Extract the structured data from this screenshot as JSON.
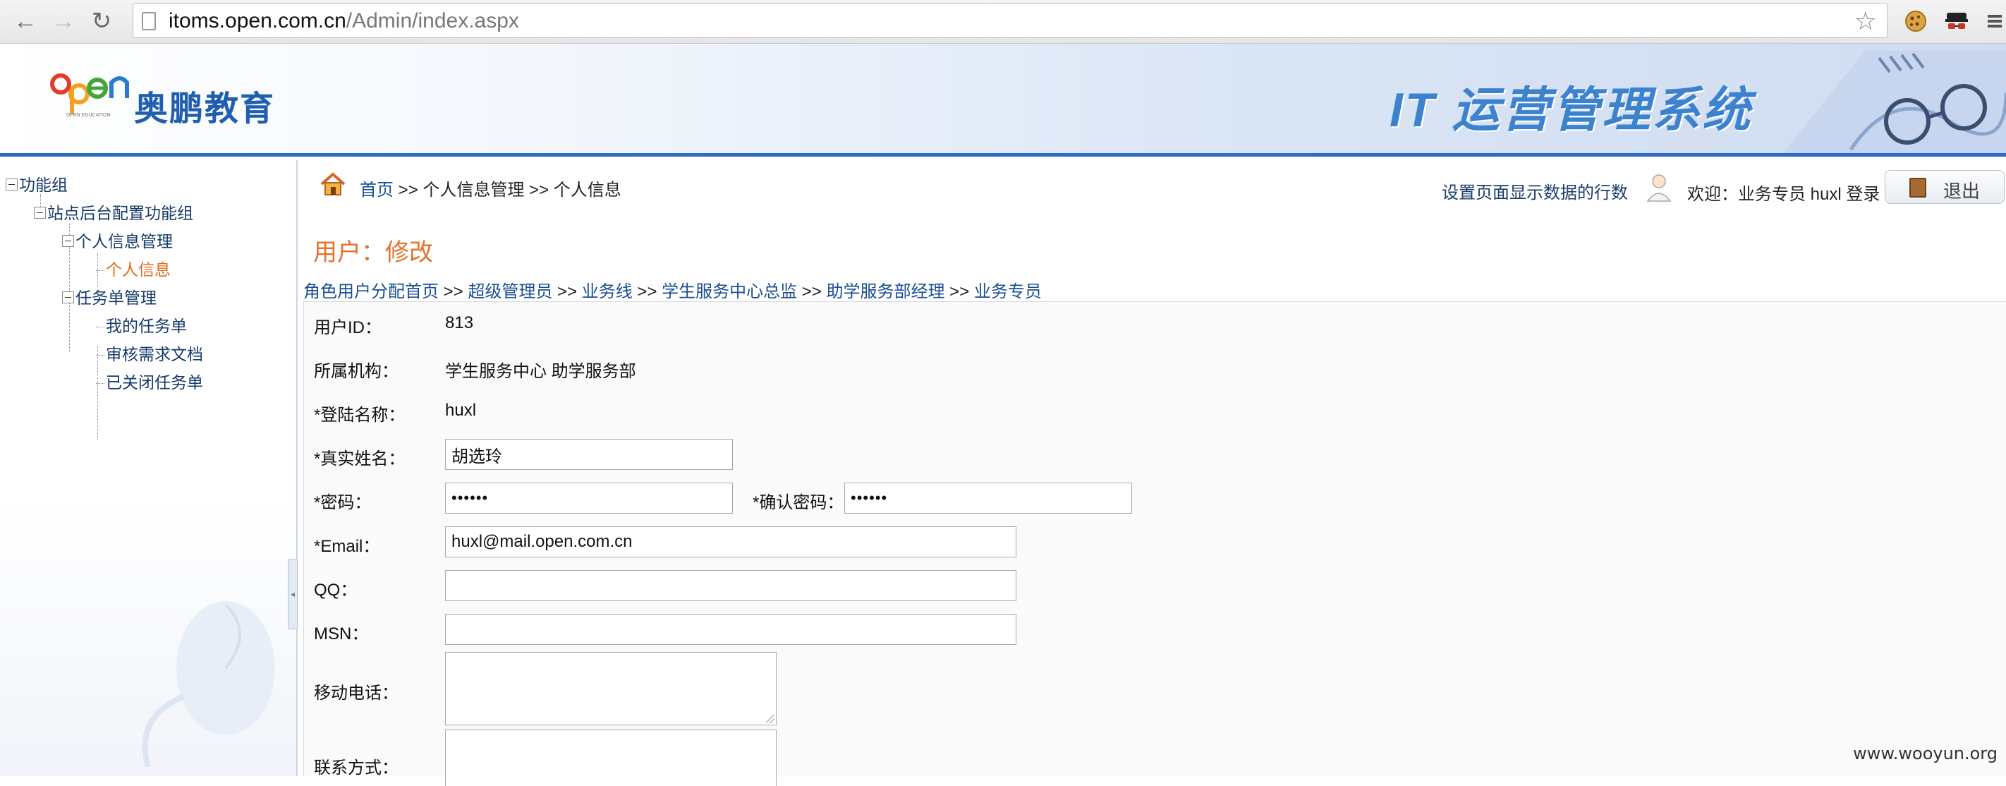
{
  "browser": {
    "url_host": "itoms.open.com.cn",
    "url_path": "/Admin/index.aspx"
  },
  "banner": {
    "logo_mark": "Open",
    "logo_text": "奥鹏教育",
    "system_title": "IT 运营管理系统"
  },
  "sidebar": {
    "items": [
      {
        "label": "功能组",
        "level": 0
      },
      {
        "label": "站点后台配置功能组",
        "level": 1
      },
      {
        "label": "个人信息管理",
        "level": 2
      },
      {
        "label": "个人信息",
        "level": 3,
        "active": true
      },
      {
        "label": "任务单管理",
        "level": 2
      },
      {
        "label": "我的任务单",
        "level": 3
      },
      {
        "label": "审核需求文档",
        "level": 3
      },
      {
        "label": "已关闭任务单",
        "level": 3
      }
    ]
  },
  "header": {
    "breadcrumb": {
      "home": "首页",
      "sep1": ">>",
      "section": "个人信息管理",
      "sep2": ">>",
      "page": "个人信息"
    },
    "set_rows_link": "设置页面显示数据的行数",
    "welcome": "欢迎：业务专员 huxl 登录",
    "logout_label": "退出"
  },
  "page": {
    "heading": "用户：修改",
    "role_path": [
      "角色用户分配首页",
      "超级管理员",
      "业务线",
      "学生服务中心总监",
      "助学服务部经理",
      "业务专员"
    ],
    "role_sep": ">>"
  },
  "form": {
    "user_id_label": "用户ID：",
    "user_id": "813",
    "org_label": "所属机构：",
    "org": "学生服务中心 助学服务部",
    "login_label": "*登陆名称：",
    "login": "huxl",
    "realname_label": "*真实姓名：",
    "realname": "胡选玲",
    "password_label": "*密码：",
    "password": "••••••",
    "confirm_label": "*确认密码：",
    "confirm": "••••••",
    "email_label": "*Email：",
    "email": "huxl@mail.open.com.cn",
    "qq_label": "QQ：",
    "qq": "",
    "msn_label": "MSN：",
    "msn": "",
    "mobile_label": "移动电话：",
    "contact_label": "联系方式："
  },
  "watermark": "www.wooyun.org"
}
